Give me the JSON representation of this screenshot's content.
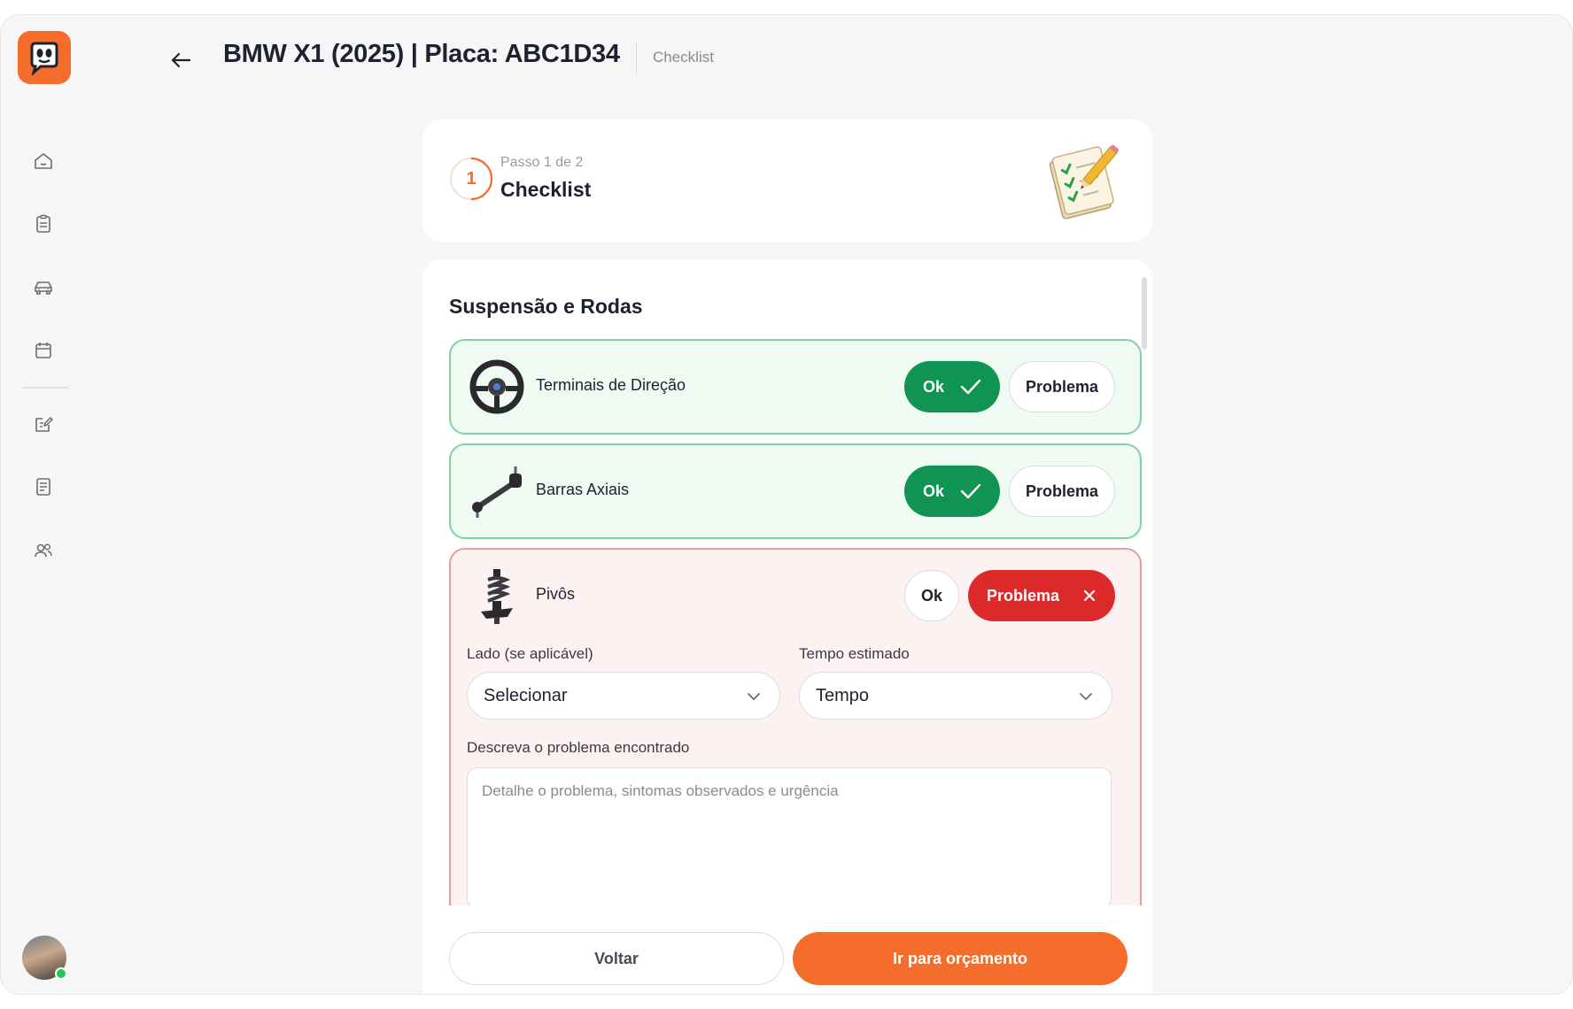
{
  "header": {
    "title": "BMW X1 (2025) | Placa:  ABC1D34",
    "breadcrumb": "Checklist"
  },
  "sidebar": {
    "items": [
      {
        "icon": "home-icon"
      },
      {
        "icon": "clipboard-icon"
      },
      {
        "icon": "car-icon"
      },
      {
        "icon": "calendar-icon"
      },
      {
        "icon": "edit-note-icon"
      },
      {
        "icon": "document-icon"
      },
      {
        "icon": "users-icon"
      }
    ],
    "user_status": "online"
  },
  "step": {
    "number": "1",
    "label": "Passo 1 de 2",
    "title": "Checklist"
  },
  "section": {
    "title": "Suspensão e Rodas"
  },
  "items": [
    {
      "label": "Terminais de Direção",
      "status": "ok",
      "icon": "steering-wheel-icon"
    },
    {
      "label": "Barras Axiais",
      "status": "ok",
      "icon": "axial-rod-icon"
    },
    {
      "label": "Pivôs",
      "status": "problema",
      "icon": "suspension-spring-icon"
    }
  ],
  "buttons": {
    "ok": "Ok",
    "problem": "Problema"
  },
  "problem_form": {
    "side_label": "Lado (se aplicável)",
    "side_value": "Selecionar",
    "time_label": "Tempo estimado",
    "time_value": "Tempo",
    "description_label": "Descreva o problema encontrado",
    "description_placeholder": "Detalhe o problema, sintomas observados e urgência"
  },
  "footer": {
    "back": "Voltar",
    "next": "Ir para orçamento"
  },
  "colors": {
    "accent": "#f46d2a",
    "ok": "#0f9451",
    "problem": "#dc2a2a"
  }
}
